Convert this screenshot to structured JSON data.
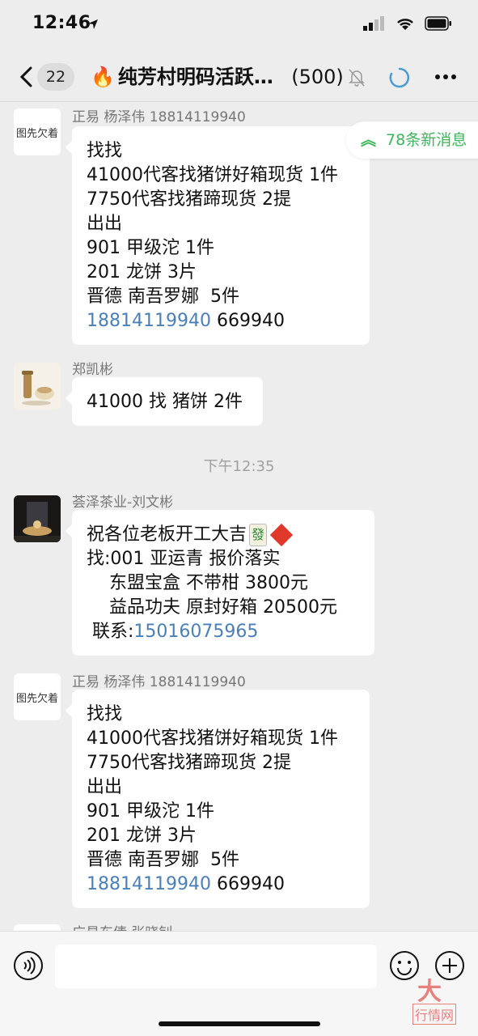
{
  "status_bar": {
    "time": "12:46"
  },
  "nav": {
    "unread_count": "22",
    "title": "纯芳村明码活跃…",
    "member_count": "(500)"
  },
  "new_messages_pill": "78条新消息",
  "messages": [
    {
      "sender": "正易  杨泽伟  18814119940",
      "avatar_text": "图先欠着",
      "lines": [
        "找找",
        "41000代客找猪饼好箱现货 1件",
        "7750代客找猪蹄现货 2提",
        "出出",
        "901 甲级沱 1件",
        "201 龙饼 3片",
        "晋德 南吾罗娜  5件"
      ],
      "phone": "18814119940",
      "phone_suffix": " 669940"
    },
    {
      "sender": "郑凯彬",
      "lines": [
        "41000 找 猪饼 2件"
      ]
    },
    {
      "sender": "荟泽茶业-刘文彬",
      "lines": [
        "祝各位老板开工大吉",
        "找:001 亚运青 报价落实",
        "    东盟宝盒 不带柑 3800元",
        "    益品功夫 原封好箱 20500元"
      ],
      "contact_label": " 联系:",
      "phone": "15016075965"
    },
    {
      "sender": "正易  杨泽伟  18814119940",
      "avatar_text": "图先欠着",
      "lines": [
        "找找",
        "41000代客找猪饼好箱现货 1件",
        "7750代客找猪蹄现货 2提",
        "出出",
        "901 甲级沱 1件",
        "201 龙饼 3片",
        "晋德 南吾罗娜  5件"
      ],
      "phone": "18814119940",
      "phone_suffix": " 669940"
    },
    {
      "sender": "广易东倩  张晓钊"
    }
  ],
  "timestamp": "下午12:35",
  "watermark": {
    "big": "大",
    "small": "行情网"
  },
  "icons": [
    "back-chevron",
    "mute-bell",
    "loading-circle",
    "more-dots",
    "voice",
    "emoji",
    "plus",
    "mahjong-fa",
    "fu-diamond"
  ]
}
